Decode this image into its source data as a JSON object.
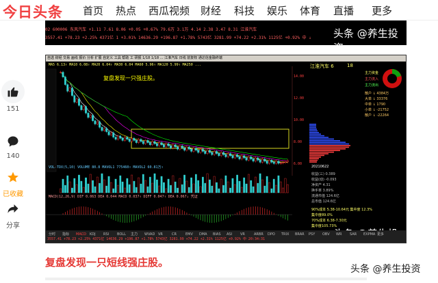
{
  "nav": {
    "logo": "今日头条",
    "items": [
      "首页",
      "热点",
      "西瓜视频",
      "财经",
      "科技",
      "娱乐",
      "体育",
      "直播",
      "更多"
    ]
  },
  "strip": {
    "row1": "02   600006  东风汽车      +1.11   7.61    8.06   +0.05  +0.67%   79.6万   3.1万  4.14  2.38   3.47  8.31    江淮汽车",
    "row2": "3557.41  +78.23  +2.25%   4371亿  1  +3.01%  14636.29  +196.87  +1.78%  5743亿  3281.99  +74.22  +2.31%  1125亿   +0.92%   中  ↓",
    "watermark": "头条 @养生投资"
  },
  "actions": {
    "like_count": "151",
    "comment_count": "140",
    "collect_label": "已收藏",
    "share_label": "分享"
  },
  "shot": {
    "menubar": "自选 财经 交易 画线 报价 分析 扩展 自定义 工具 帮助   工  研报  1/18 1/18 ...   江淮汽车  日线  前复权   通达信金融终端",
    "ma_info": "MA5 6.13↑  MA10 6.08↑  MA20 6.04↑  MA30 6.04  MA60 5.96↑  MA120 5.99↑  MA250 ...",
    "annotation": "复盘发现一只强庄股。",
    "vol_info": "VOL-TDX(5,10) VOLUME 80.8 MAVOL1 775460↑  MAVOL2 60.81万↑",
    "macd_info": "MACD(12,26,9) DIF 0.063  DEA 0.044  MACD 0.037↑  DIFF 0.047↑  DEA 0.067↓  凭证",
    "stock_name": "江淮汽车 6",
    "stock_num": "18",
    "fund_title": "主力资金",
    "fund_in": "主力流入",
    "fund_out": "主力流出",
    "right_lines": [
      "散户 ↓ 4384万",
      "大单 ↓ 33376",
      "中单 ↓ 1790",
      "小单 ↓ -21752",
      "散户 ↓ -22264"
    ],
    "date": "20210622",
    "quote_lines": [
      "收益(三) 0.389",
      "收益(动) -0.093",
      "净资产 4.31",
      "换手率 3.89%",
      "流通市值 124.6亿",
      "总市值 124.6亿"
    ],
    "notes": [
      "90%成本 5.38-10.64元 集中度 12.3%",
      "集中度89.0%",
      "70%成本 6.38-7.30元",
      "集中度105.73%"
    ],
    "tabs": [
      "分时",
      "指标",
      "MACD",
      "KDJ",
      "RSI",
      "BOLL",
      "主力",
      "WVAD",
      "VR",
      "CR",
      "EMV",
      "DMA",
      "BIAS",
      "ASI",
      "VR",
      "ARBR",
      "DPO",
      "TRIX",
      "BRAR",
      "PSY",
      "OBV",
      "WR",
      "SAR",
      "EXPMA",
      "更多"
    ],
    "status": "3557.41 +78.23 +2.25% 4371亿  14636.29 +196.87 +1.78% 5743亿  3281.99 +74.22 +2.31% 1125亿  +0.92% 中  20:34:31",
    "watermark": "头条 @养生投资"
  },
  "article": {
    "headline": "复盘发现一只短线强庄股。",
    "watermark": "头条 @养生投资"
  },
  "colors": {
    "brand": "#f04142",
    "headline": "#e53935",
    "collect": "#ff9900"
  },
  "chart_data": {
    "type": "line",
    "xlabel": "",
    "ylabel": "",
    "series": [
      {
        "name": "",
        "values": [
          14.34,
          13.9,
          13.2,
          12.6,
          12.9,
          12.2,
          11.6,
          11.9,
          11.3,
          10.9,
          11.2,
          10.6,
          10.2,
          10.4,
          9.9,
          9.6,
          9.8,
          9.3,
          9.0,
          9.2,
          8.9,
          8.6,
          8.8,
          8.4,
          8.2,
          8.5,
          8.3,
          8.1,
          8.4,
          8.2,
          8.0,
          8.3,
          8.1,
          7.9,
          8.2,
          8.0,
          7.8,
          8.1,
          7.9,
          7.7,
          8.0,
          7.8,
          7.6,
          7.9,
          7.7,
          7.5,
          7.8,
          7.6,
          7.4,
          7.7,
          7.5,
          7.3,
          7.6,
          7.4,
          7.2,
          7.5,
          7.3,
          7.1,
          7.4,
          7.2,
          7.0,
          7.3,
          7.1,
          6.9,
          7.2,
          7.0,
          6.8,
          7.1,
          6.9,
          6.7,
          7.0,
          6.8,
          6.6,
          6.9,
          6.7,
          6.5,
          6.8,
          6.6,
          6.4,
          6.7,
          6.5,
          6.3,
          6.6,
          6.4,
          6.2,
          6.5,
          6.3,
          6.1,
          6.4,
          6.2,
          6.0,
          6.3,
          6.1,
          5.99,
          6.2,
          6.0,
          6.04,
          6.08,
          6.13,
          6.25
        ]
      }
    ],
    "ylim": [
      5.5,
      14.5
    ]
  }
}
